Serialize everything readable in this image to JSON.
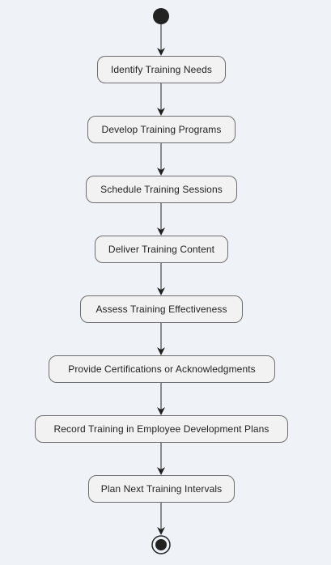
{
  "diagram": {
    "type": "activity",
    "start_node": "initial",
    "end_node": "final",
    "steps": [
      {
        "label": "Identify Training Needs"
      },
      {
        "label": "Develop Training Programs"
      },
      {
        "label": "Schedule Training Sessions"
      },
      {
        "label": "Deliver Training Content"
      },
      {
        "label": "Assess Training Effectiveness"
      },
      {
        "label": "Provide Certifications or Acknowledgments"
      },
      {
        "label": "Record Training in Employee Development Plans"
      },
      {
        "label": "Plan Next Training Intervals"
      }
    ],
    "colors": {
      "background": "#eff3f8",
      "node_fill": "#f2f2f2",
      "node_border": "#6e6e6e",
      "edge": "#222222",
      "terminal": "#222222"
    }
  }
}
